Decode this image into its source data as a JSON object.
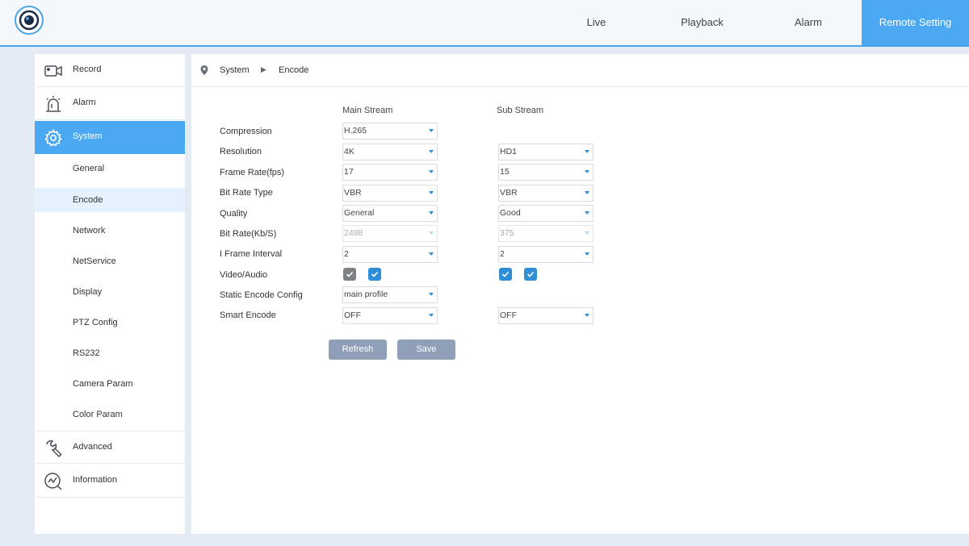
{
  "topnav": {
    "tabs": [
      {
        "label": "Live"
      },
      {
        "label": "Playback"
      },
      {
        "label": "Alarm"
      },
      {
        "label": "Remote Setting"
      }
    ]
  },
  "sidebar": {
    "record": "Record",
    "alarm": "Alarm",
    "system": "System",
    "system_items": [
      "General",
      "Encode",
      "Network",
      "NetService",
      "Display",
      "PTZ Config",
      "RS232",
      "Camera Param",
      "Color Param"
    ],
    "advanced": "Advanced",
    "information": "Information"
  },
  "breadcrumb": {
    "section": "System",
    "page": "Encode"
  },
  "encode": {
    "main_stream_label": "Main Stream",
    "sub_stream_label": "Sub Stream",
    "rows": {
      "compression": {
        "label": "Compression",
        "main": "H.265"
      },
      "resolution": {
        "label": "Resolution",
        "main": "4K",
        "sub": "HD1"
      },
      "frame_rate": {
        "label": "Frame Rate(fps)",
        "main": "17",
        "sub": "15"
      },
      "bit_rate_type": {
        "label": "Bit Rate Type",
        "main": "VBR",
        "sub": "VBR"
      },
      "quality": {
        "label": "Quality",
        "main": "General",
        "sub": "Good"
      },
      "bit_rate": {
        "label": "Bit Rate(Kb/S)",
        "main": "2488",
        "sub": "375"
      },
      "i_frame": {
        "label": "I Frame Interval",
        "main": "2",
        "sub": "2"
      },
      "video_audio": {
        "label": "Video/Audio",
        "main_video": true,
        "main_audio": true,
        "sub_video": true,
        "sub_audio": true
      },
      "static_encode": {
        "label": "Static Encode Config",
        "main": "main profile"
      },
      "smart_encode": {
        "label": "Smart Encode",
        "main": "OFF",
        "sub": "OFF"
      }
    }
  },
  "buttons": {
    "refresh": "Refresh",
    "save": "Save"
  },
  "colors": {
    "accent": "#4aa9f2",
    "button": "#8f9fb8",
    "check": "#2e8fd8"
  }
}
